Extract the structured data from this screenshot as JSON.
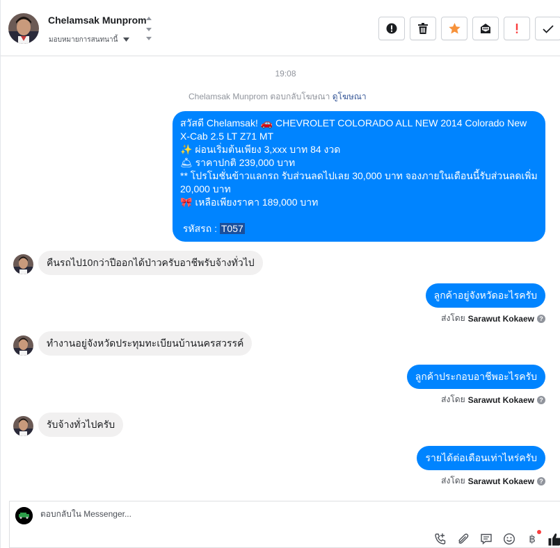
{
  "header": {
    "contact_name": "Chelamsak Munprom",
    "assign_label": "มอบหมายการสนทนานี้"
  },
  "toolbar": {
    "buttons": [
      "report-icon",
      "trash-icon",
      "star-icon",
      "mark-unread-icon",
      "exclamation-icon",
      "check-icon"
    ]
  },
  "thread": {
    "timestamp": "19:08",
    "ad_reply_text": "Chelamsak Munprom ตอบกลับโฆษณา",
    "ad_reply_link": "ดูโฆษณา",
    "ad_message": {
      "line1": "สวัสดี Chelamsak! 🚗  CHEVROLET COLORADO ALL NEW 2014 Colorado New X-Cab 2.5 LT Z71 MT",
      "line2": "✨  ผ่อนเริ่มต้นเพียง 3,xxx บาท 84 งวด",
      "line3": "🛎 ราคาปกติ 239,000 บาท",
      "line4": "** โปรโมชั่นข้าวแลกรถ รับส่วนลดไปเลย 30,000 บาท จองภายในเดือนนี้รับส่วนลดเพิ่ม 20,000 บาท",
      "line5": "🎀  เหลือเพียงราคา 189,000 บาท",
      "code_label": " รหัสรถ : ",
      "code_value": "T057"
    },
    "messages": [
      {
        "side": "in",
        "text": "คืนรถไป10กว่าปีออกได้ป่าวครับอาชีพรับจ้างทั่วไป"
      },
      {
        "side": "out",
        "text": "ลูกค้าอยู่จังหวัดอะไรครับ",
        "sent_by_label": "ส่งโดย",
        "sender": "Sarawut Kokaew"
      },
      {
        "side": "in",
        "text": "ทำงานอยู่จังหวัดประทุมทะเบียนบ้านนครสวรรค์"
      },
      {
        "side": "out",
        "text": "ลูกค้าประกอบอาชีพอะไรครับ",
        "sent_by_label": "ส่งโดย",
        "sender": "Sarawut Kokaew"
      },
      {
        "side": "in",
        "text": "รับจ้างทั่วไปครับ"
      },
      {
        "side": "out",
        "text": "รายได้ต่อเดือนเท่าไหร่ครับ",
        "sent_by_label": "ส่งโดย",
        "sender": "Sarawut Kokaew"
      }
    ]
  },
  "composer": {
    "placeholder": "ตอบกลับใน Messenger...",
    "icons": [
      "add-call-icon",
      "attachment-icon",
      "saved-reply-icon",
      "emoji-icon",
      "payment-icon",
      "like-icon"
    ],
    "payment_symbol": "฿"
  },
  "colors": {
    "outgoing_bubble": "#0084ff",
    "incoming_bubble": "#f1f0f0",
    "link": "#385898",
    "star": "#f7923b",
    "alert_red": "#fa3e3e"
  }
}
